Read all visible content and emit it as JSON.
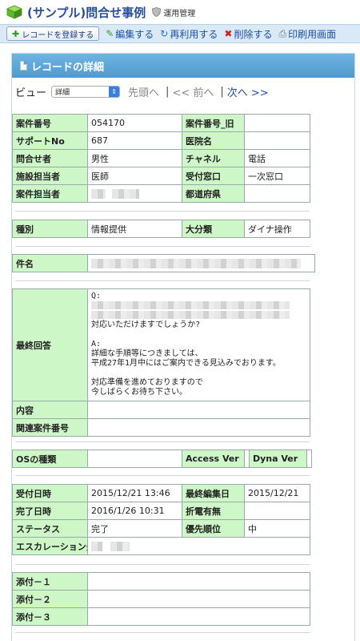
{
  "header": {
    "title": "(サンプル)問合せ事例",
    "admin_link": "運用管理"
  },
  "toolbar": {
    "register_label": "レコードを登録する",
    "edit_label": "編集する",
    "reuse_label": "再利用する",
    "delete_label": "削除する",
    "print_label": "印刷用画面"
  },
  "panel": {
    "title": "レコードの詳細"
  },
  "view": {
    "label": "ビュー",
    "selected": "詳細",
    "first": "先頭へ",
    "prev": "<< 前へ",
    "next": "次へ >>"
  },
  "section1": {
    "case_no_label": "案件番号",
    "case_no": "054170",
    "case_no_old_label": "案件番号_旧",
    "case_no_old": "",
    "support_no_label": "サポートNo",
    "support_no": "687",
    "hospital_label": "医院名",
    "hospital": "",
    "inquirer_label": "問合せ者",
    "inquirer": "男性",
    "channel_label": "チャネル",
    "channel": "電話",
    "facility_staff_label": "施設担当者",
    "facility_staff": "医師",
    "reception_label": "受付窓口",
    "reception": "一次窓口",
    "case_staff_label": "案件担当者",
    "prefecture_label": "都道府県",
    "prefecture": ""
  },
  "section2": {
    "type_label": "種別",
    "type": "情報提供",
    "category_label": "大分類",
    "category": "ダイナ操作"
  },
  "section3": {
    "subject_label": "件名"
  },
  "section4": {
    "final_answer_label": "最終回答",
    "answer_q": "Q:",
    "answer_q_tail": "対応いただけますでしょうか?",
    "answer_a": "A:\n詳細な手順等につきましては、\n平成27年1月中にはご案内できる見込みでおります。\n\n対応準備を進めておりますので\n今しばらくお待ち下さい。",
    "content_label": "内容",
    "content": "",
    "related_label": "関連案件番号",
    "related": ""
  },
  "section5": {
    "os_label": "OSの種類",
    "os": "",
    "access_label": "Access Ver",
    "access": "",
    "dyna_label": "Dyna Ver",
    "dyna": ""
  },
  "section6": {
    "received_label": "受付日時",
    "received": "2015/12/21 13:46",
    "edited_label": "最終編集日",
    "edited": "2015/12/21",
    "completed_label": "完了日時",
    "completed": "2016/1/26 10:31",
    "callback_label": "折電有無",
    "callback": "",
    "status_label": "ステータス",
    "status": "完了",
    "priority_label": "優先順位",
    "priority": "中",
    "escalation_label": "エスカレーション先"
  },
  "section7": {
    "attach1_label": "添付－１",
    "attach1": "",
    "attach2_label": "添付－２",
    "attach2": "",
    "attach3_label": "添付－３",
    "attach3": ""
  }
}
